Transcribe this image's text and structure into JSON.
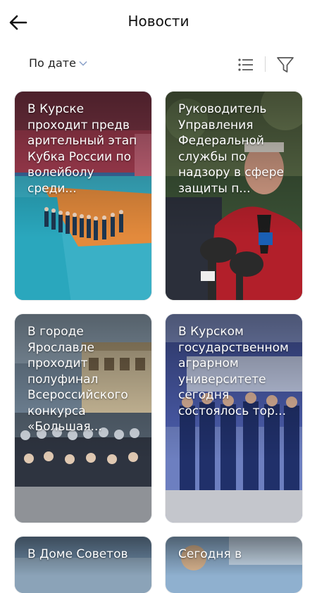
{
  "header": {
    "title": "Новости"
  },
  "toolbar": {
    "sort_label": "По дате"
  },
  "news": [
    {
      "text": "В Курске проходит предв арительный этап Кубка России по волейболу среди..."
    },
    {
      "text": "Руководитель Управления Федеральной службы по надзору в сфере защиты п..."
    },
    {
      "text": "В городе Ярославле проходит полуфинал Всероссийского конкурса «Большая..."
    },
    {
      "text": "В Курском государственном аграрном университете сегодня состоялось тор..."
    },
    {
      "text": "В Доме Советов"
    },
    {
      "text": "Сегодня в"
    }
  ],
  "icons": {
    "back": "arrow-left-icon",
    "sort_chevron": "chevron-down-icon",
    "list": "list-icon",
    "filter": "filter-icon"
  },
  "colors": {
    "background": "#ffffff",
    "text": "#111111",
    "card_text": "#ffffff"
  }
}
